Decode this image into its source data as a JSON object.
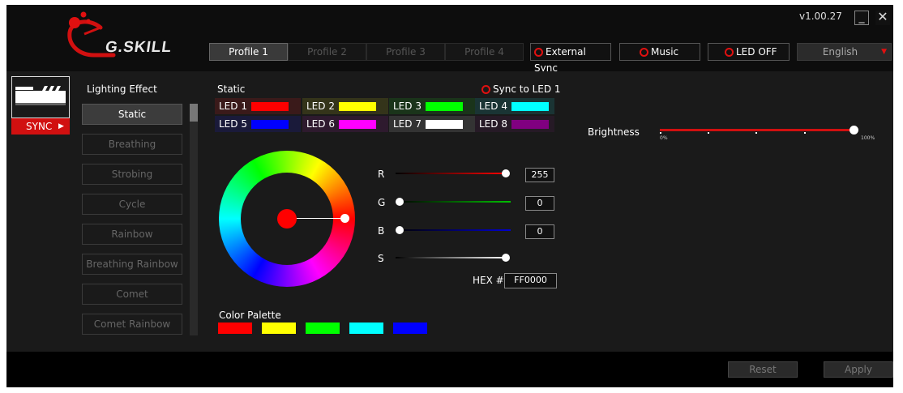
{
  "app": {
    "brand": "G.SKILL",
    "version": "v1.00.27",
    "minimize_label": "_",
    "close_label": "✕"
  },
  "profiles": [
    "Profile 1",
    "Profile 2",
    "Profile 3",
    "Profile 4"
  ],
  "active_profile": "Profile 1",
  "toggles": {
    "external_sync": "External Sync",
    "music": "Music",
    "led_off": "LED OFF"
  },
  "language": {
    "selected": "English"
  },
  "sync_button": "SYNC",
  "effects": {
    "heading": "Lighting Effect",
    "selected": "Static",
    "items": [
      "Static",
      "Breathing",
      "Strobing",
      "Cycle",
      "Rainbow",
      "Breathing Rainbow",
      "Comet",
      "Comet Rainbow"
    ]
  },
  "static_panel": {
    "title": "Static",
    "sync_label": "Sync to LED 1",
    "leds": [
      {
        "label": "LED 1",
        "color": "#ff0000",
        "bg": "#3a1a1a"
      },
      {
        "label": "LED 2",
        "color": "#ffff00",
        "bg": "#34341a"
      },
      {
        "label": "LED 3",
        "color": "#00ff00",
        "bg": "#1a341a"
      },
      {
        "label": "LED 4",
        "color": "#00ffff",
        "bg": "#1a3434"
      },
      {
        "label": "LED 5",
        "color": "#0000ff",
        "bg": "#1a1a3a"
      },
      {
        "label": "LED 6",
        "color": "#ff00ff",
        "bg": "#2e1a2e"
      },
      {
        "label": "LED 7",
        "color": "#ffffff",
        "bg": "#333333"
      },
      {
        "label": "LED 8",
        "color": "#800080",
        "bg": "#261a26"
      }
    ]
  },
  "color": {
    "r": {
      "label": "R",
      "value": "255"
    },
    "g": {
      "label": "G",
      "value": "0"
    },
    "b": {
      "label": "B",
      "value": "0"
    },
    "s": {
      "label": "S"
    },
    "hex_label": "HEX #",
    "hex_value": "FF0000",
    "current": "#ff0000"
  },
  "palette": {
    "heading": "Color Palette",
    "colors": [
      "#ff0000",
      "#ffff00",
      "#00ff00",
      "#00ffff",
      "#0000ff"
    ]
  },
  "brightness": {
    "label": "Brightness",
    "min_label": "0%",
    "max_label": "100%",
    "value_percent": 100
  },
  "footer": {
    "reset": "Reset",
    "apply": "Apply"
  }
}
